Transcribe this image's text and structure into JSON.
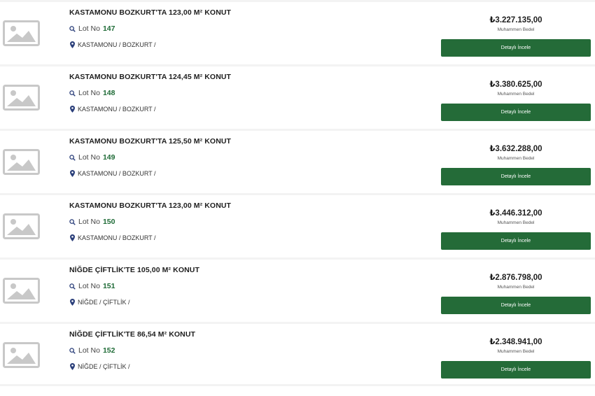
{
  "listings": [
    {
      "title": "KASTAMONU BOZKURT'TA 123,00 M² KONUT",
      "lot_label": "Lot No",
      "lot_number": "147",
      "location": "KASTAMONU / BOZKURT /",
      "price": "₺3.227.135,00",
      "price_label": "Muhammen Bedel",
      "button_label": "Detaylı İncele"
    },
    {
      "title": "KASTAMONU BOZKURT'TA 124,45 M² KONUT",
      "lot_label": "Lot No",
      "lot_number": "148",
      "location": "KASTAMONU / BOZKURT /",
      "price": "₺3.380.625,00",
      "price_label": "Muhammen Bedel",
      "button_label": "Detaylı İncele"
    },
    {
      "title": "KASTAMONU BOZKURT'TA 125,50 M² KONUT",
      "lot_label": "Lot No",
      "lot_number": "149",
      "location": "KASTAMONU / BOZKURT /",
      "price": "₺3.632.288,00",
      "price_label": "Muhammen Bedel",
      "button_label": "Detaylı İncele"
    },
    {
      "title": "KASTAMONU BOZKURT'TA 123,00 M² KONUT",
      "lot_label": "Lot No",
      "lot_number": "150",
      "location": "KASTAMONU / BOZKURT /",
      "price": "₺3.446.312,00",
      "price_label": "Muhammen Bedel",
      "button_label": "Detaylı İncele"
    },
    {
      "title": "NİĞDE ÇİFTLİK'TE 105,00 M² KONUT",
      "lot_label": "Lot No",
      "lot_number": "151",
      "location": "NİĞDE / ÇİFTLİK /",
      "price": "₺2.876.798,00",
      "price_label": "Muhammen Bedel",
      "button_label": "Detaylı İncele"
    },
    {
      "title": "NİĞDE ÇİFTLİK'TE 86,54 M² KONUT",
      "lot_label": "Lot No",
      "lot_number": "152",
      "location": "NİĞDE / ÇİFTLİK /",
      "price": "₺2.348.941,00",
      "price_label": "Muhammen Bedel",
      "button_label": "Detaylı İncele"
    }
  ],
  "icons": {
    "thumbnail": "image-placeholder-icon",
    "lot": "search-icon",
    "location": "map-pin-icon"
  },
  "colors": {
    "accent": "#246b38",
    "lot_number": "#1f6b37",
    "divider": "#f3f3f3",
    "placeholder": "#c8c8c8"
  }
}
